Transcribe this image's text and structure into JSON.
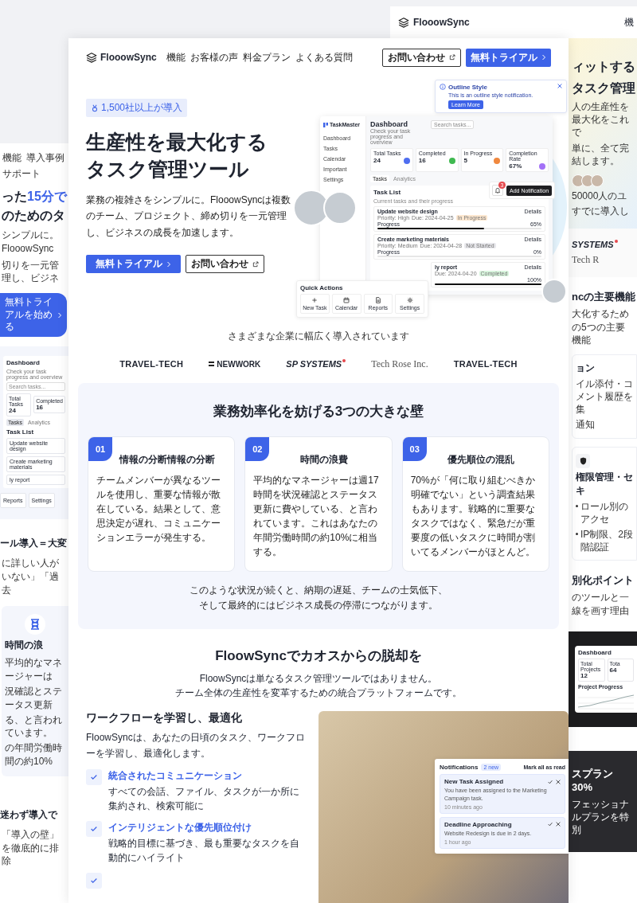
{
  "left_page": {
    "nav": [
      "機能",
      "導入事例",
      "サポート"
    ],
    "headline_start": "った",
    "headline_accent": "15分で",
    "headline_2": "のためのタ",
    "description": [
      "シンプルに。FlooowSync",
      "切りを一元管理し、ビジネ"
    ],
    "cta": "無料トライアルを始める",
    "dashboard": {
      "title": "Dashboard",
      "subtitle": "Check your task progress and overview",
      "search_placeholder": "Search tasks...",
      "stats": [
        {
          "label": "Total Tasks",
          "value": "24"
        },
        {
          "label": "Completed",
          "value": "16"
        }
      ],
      "tabs": [
        {
          "label": "Tasks",
          "selected": true
        },
        {
          "label": "Analytics",
          "selected": false
        }
      ],
      "task_list_title": "Task List",
      "tasks": [
        "Update website design",
        "Create marketing materials",
        "ly report"
      ],
      "quick_actions": [
        "Reports",
        "Settings"
      ]
    },
    "section_title": "ール導入＝大変",
    "section_text": "に詳しい人がいない」「過去",
    "card": {
      "title": "時間の浪",
      "lines": [
        "平均的なマネージャーは",
        "況確認とステータス更新",
        "る、と言われています。",
        "の年間労働時間の約10%"
      ]
    },
    "section_2_title": "迷わず導入で",
    "section_2_text": "「導入の壁」を徹底的に排除"
  },
  "right_page": {
    "logo": "FlooowSync",
    "nav_cut": "機",
    "headline": [
      "ィットする",
      "タスク管理"
    ],
    "description": [
      "人の生産性を最大化をこれで",
      "単に、全て完結します。"
    ],
    "user_count": [
      "50000人のユ",
      "すでに導入し"
    ],
    "logos": [
      {
        "name": "SYSTEMS",
        "kind": "italic-dot"
      },
      {
        "name": "Tech R",
        "kind": "serif"
      }
    ],
    "features_title": "ncの主要機能",
    "features_subtitle": "大化するための5つの主要機能",
    "feature_card": {
      "title": "ョン",
      "lines": [
        "イル添付・コメント履歴を集",
        "通知"
      ]
    },
    "security_card": {
      "title": "権限管理・セキ",
      "bullets": [
        "ロール別のアクセ",
        "IP制限、2段階認証"
      ]
    },
    "diff_title": "別化ポイント",
    "diff_subtitle": "のツールと一線を画す理由",
    "screenshot": {
      "title": "Dashboard",
      "cards": [
        {
          "label": "Total Projects",
          "value": "12"
        },
        {
          "label": "Tota",
          "value": "64"
        }
      ],
      "chart_title": "Project Progress"
    },
    "promo_title": "スプラン 30%",
    "promo_text": "フェッショナルプランを特別"
  },
  "main_page": {
    "nav": {
      "logo": "FlooowSync",
      "links": [
        "機能",
        "お客様の声",
        "料金プラン",
        "よくある質問"
      ],
      "contact": "お問い合わせ",
      "trial": "無料トライアル"
    },
    "hero": {
      "badge": "1,500社以上が導入",
      "title": [
        "生産性を最大化する",
        "タスク管理ツール"
      ],
      "description": "業務の複雑さをシンプルに。FlooowSyncは複数のチーム、プロジェクト、締め切りを一元管理し、ビジネスの成長を加速します。",
      "trial": "無料トライアル",
      "contact": "お問い合わせ",
      "dashboard": {
        "brand": "TaskMaster",
        "nav": [
          "Dashboard",
          "Tasks",
          "Calendar",
          "Important",
          "Settings"
        ],
        "title": "Dashboard",
        "subtitle": "Check your task progress and overview",
        "search_placeholder": "Search tasks...",
        "stats": [
          {
            "label": "Total Tasks",
            "value": "24",
            "color": "#4f6ef0"
          },
          {
            "label": "Completed",
            "value": "16",
            "color": "#3fb950"
          },
          {
            "label": "In Progress",
            "value": "5",
            "color": "#f0883e"
          },
          {
            "label": "Completion Rate",
            "value": "67%",
            "color": "#a371f7"
          }
        ],
        "tabs": [
          {
            "label": "Tasks",
            "selected": true
          },
          {
            "label": "Analytics",
            "selected": false
          }
        ],
        "task_list_title": "Task List",
        "task_list_subtitle": "Current tasks and their progress",
        "tasks": [
          {
            "title": "Update website design",
            "priority": "Priority: High",
            "due": "Due: 2024-04-25",
            "status": "In Progress",
            "color": "#fde7cf",
            "action": "Details",
            "progress_label": "Progress",
            "reading": "65%",
            "level": 0.65
          },
          {
            "title": "Create marketing materials",
            "priority": "Priority: Medium",
            "due": "Due: 2024-04-28",
            "status": "Not Started",
            "color": "#e8e8ec",
            "action": "Details",
            "progress_label": "Progress",
            "reading": "0%",
            "level": 0
          },
          {
            "title": "ly report",
            "due": "Due: 2024-04-20",
            "status": "Completed",
            "color": "#d8f5dd",
            "action": "Details",
            "reading": "100%",
            "level": 1
          }
        ]
      },
      "toast": {
        "title": "Outline Style",
        "text": "This is an outline style notification.",
        "button": "Learn More"
      },
      "notification_badge": "3",
      "add_notification": "Add Notification",
      "quick_actions": {
        "title": "Quick Actions",
        "items": [
          {
            "label": "New Task",
            "kind": "plus"
          },
          {
            "label": "Calendar",
            "kind": "calendar"
          },
          {
            "label": "Reports",
            "kind": "document"
          },
          {
            "label": "Settings",
            "kind": "gear"
          }
        ]
      }
    },
    "clients": {
      "caption": "さまざまな企業に幅広く導入されています",
      "logos": [
        {
          "name": "TRAVEL-TECH",
          "kind": "wordmark"
        },
        {
          "name": "NEWWORK",
          "kind": "bars"
        },
        {
          "name": "SP SYSTEMS",
          "kind": "italic-dot"
        },
        {
          "name": "Tech Rose Inc.",
          "kind": "serif"
        },
        {
          "name": "TRAVEL-TECH",
          "kind": "wordmark"
        }
      ]
    },
    "problems": {
      "title": "業務効率化を妨げる3つの大きな壁",
      "cards": [
        {
          "number": "01",
          "title": "情報の分断情報の分断",
          "text": "チームメンバーが異なるツールを使用し、重要な情報が散在している。結果として、意思決定が遅れ、コミュニケーションエラーが発生する。"
        },
        {
          "number": "02",
          "title": "時間の浪費",
          "text": "平均的なマネージャーは週17時間を状況確認とステータス更新に費やしている、と言われています。これはあなたの年間労働時間の約10%に相当する。"
        },
        {
          "number": "03",
          "title": "優先順位の混乱",
          "text": "70%が「何に取り組むべきか明確でない」という調査結果もあります。戦略的に重要なタスクではなく、緊急だが重要度の低いタスクに時間が割いてるメンバーがほとんど。"
        }
      ],
      "footer": [
        "このような状況が続くと、納期の遅延、チームの士気低下、",
        "そして最終的にはビジネス成長の停滞につながります。"
      ]
    },
    "solution": {
      "title": "FloowSyncでカオスからの脱却を",
      "subtitle": [
        "FloowSyncは単なるタスク管理ツールではありません。",
        "チーム全体の生産性を変革するための統合プラットフォームです。"
      ],
      "feature_title": "ワークフローを学習し、最適化",
      "feature_text": "FloowSyncは、あなたの日頃のタスク、ワークフローを学習し、最適化します。",
      "items": [
        {
          "title": "統合されたコミュニケーション",
          "text": "すべての会話、ファイル、タスクが一か所に集約され、検索可能に"
        },
        {
          "title": "インテリジェントな優先順位付け",
          "text": "戦略的目標に基づき、最も重要なタスクを自動的にハイライト"
        }
      ],
      "notifications": {
        "title": "Notifications",
        "badge": "2 new",
        "action": "Mark all as read",
        "items": [
          {
            "title": "New Task Assigned",
            "text": "You have been assigned to the Marketing Campaign task.",
            "time": "10 minutes ago"
          },
          {
            "title": "Deadline Approaching",
            "text": "Website Redesign is due in 2 days.",
            "time": "1 hour ago"
          }
        ]
      }
    }
  }
}
